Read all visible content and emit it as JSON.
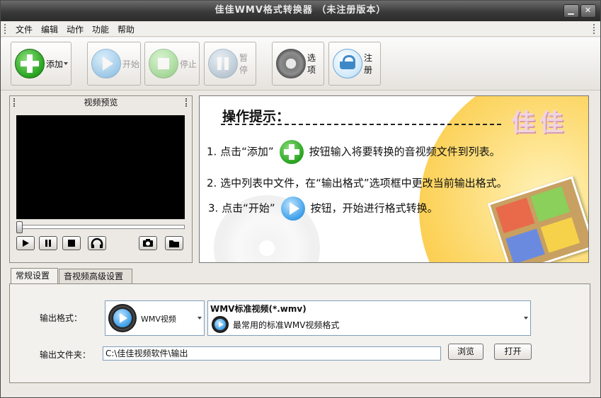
{
  "window": {
    "title": "佳佳WMV格式转换器  （未注册版本）",
    "buttons": {
      "minimize": "▁",
      "close": "✕"
    }
  },
  "menu": [
    "文件",
    "编辑",
    "动作",
    "功能",
    "帮助"
  ],
  "toolbar": {
    "add": "添加",
    "start": "开始",
    "stop": "停止",
    "pause": "暂停",
    "options": "选项",
    "register": "注册"
  },
  "preview": {
    "title": "视频预览"
  },
  "tips": {
    "title": "操作提示：",
    "brand": "佳佳",
    "line1_a": "1. 点击“添加”",
    "line1_b": "按钮输入将要转换的音视频文件到列表。",
    "line2": "2. 选中列表中文件，在“输出格式”选项框中更改当前输出格式。",
    "line3_a": "3. 点击“开始”",
    "line3_b": "按钮，开始进行格式转换。"
  },
  "tabs": [
    "常规设置",
    "音视频高级设置"
  ],
  "settings": {
    "format_label": "输出格式：",
    "format_category": "WMV视频",
    "format_name": "WMV标准视频(*.wmv)",
    "format_desc": "最常用的标准WMV视频格式",
    "folder_label": "输出文件夹：",
    "folder_value": "C:\\佳佳视频软件\\输出",
    "browse": "浏览",
    "open": "打开"
  }
}
